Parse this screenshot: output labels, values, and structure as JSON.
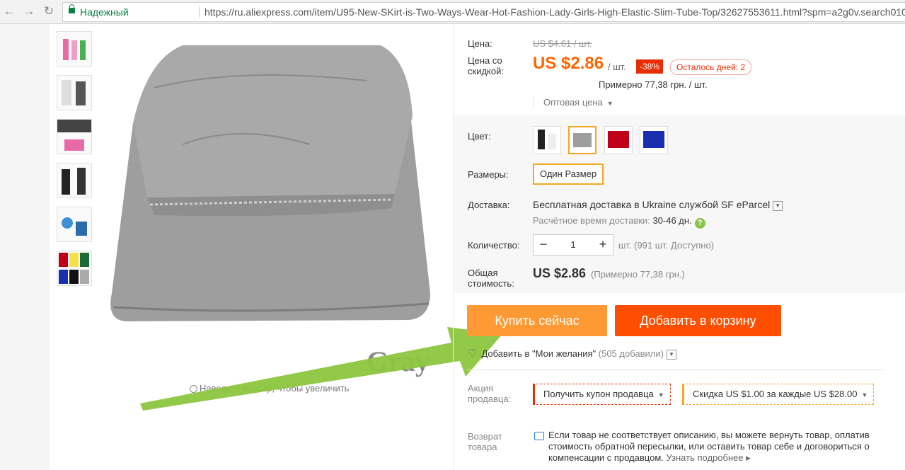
{
  "browser": {
    "secure_label": "Надежный",
    "url": "https://ru.aliexpress.com/item/U95-New-SKirt-is-Two-Ways-Wear-Hot-Fashion-Lady-Girls-High-Elastic-Slim-Tube-Top/32627553611.html?spm=a2g0v.search0104.3.330.oVv"
  },
  "gallery": {
    "image_caption": "Gray",
    "zoom_hint": "Наведите курсор, чтобы увеличить"
  },
  "price": {
    "label": "Цена:",
    "old": "US $4.61 / шт.",
    "discount_label": "Цена со скидкой:",
    "new": "US $2.86",
    "unit": "/ шт.",
    "discount_badge": "-38%",
    "days_left": "Осталось дней: 2",
    "approx": "Примерно 77,38 грн. / шт.",
    "wholesale": "Оптовая цена"
  },
  "options": {
    "color_label": "Цвет:",
    "colors": [
      "black-white",
      "gray",
      "red",
      "blue"
    ],
    "color_hex": {
      "gray": "#9e9e9e",
      "red": "#c0001a",
      "blue": "#1a2fb0"
    },
    "size_label": "Размеры:",
    "size_value": "Один Размер"
  },
  "shipping": {
    "label": "Доставка:",
    "main": "Бесплатная доставка в Ukraine службой SF eParcel",
    "eta_label": "Расчётное время доставки:",
    "eta_days": "30-46 дн."
  },
  "quantity": {
    "label": "Количество:",
    "minus": "−",
    "value": "1",
    "plus": "+",
    "note": "шт. (991 шт. Доступно)"
  },
  "total": {
    "label": "Общая стоимость:",
    "value": "US $2.86",
    "approx": "(Примерно 77,38 грн.)"
  },
  "actions": {
    "buy_now": "Купить сейчас",
    "add_to_cart": "Добавить в корзину",
    "wishlist": "Добавить в \"Мои желания\"",
    "wishlist_count": "(505 добавили)"
  },
  "promo": {
    "label": "Акция продавца:",
    "coupon": "Получить купон продавца",
    "discount": "Скидка US $1.00 за каждые US $28.00"
  },
  "returns": {
    "label": "Возврат товара",
    "text": "Если товар не соответствует описанию, вы можете вернуть товар, оплатив стоимость обратной пересылки, или оставить товар себе и договориться о компенсации с продавцом.",
    "link": "Узнать подробнее"
  },
  "colors": {
    "accent_orange": "#ff9933",
    "cart_orange": "#ff4e00",
    "price_orange": "#ff6600",
    "annotation_arrow": "#8dc63f"
  }
}
